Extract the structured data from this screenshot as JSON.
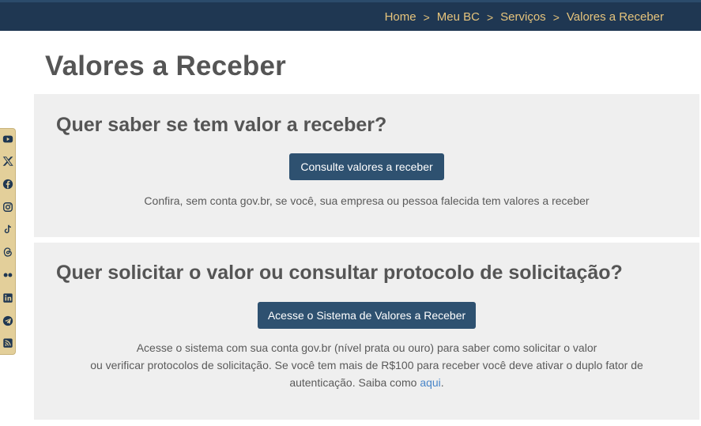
{
  "breadcrumb": {
    "items": [
      "Home",
      "Meu BC",
      "Serviços",
      "Valores a Receber"
    ],
    "separator": ">"
  },
  "page": {
    "title": "Valores a Receber"
  },
  "section1": {
    "heading": "Quer saber se tem valor a receber?",
    "button": "Consulte valores a receber",
    "description": "Confira, sem conta gov.br, se você, sua empresa ou pessoa falecida tem valores a receber"
  },
  "section2": {
    "heading": "Quer solicitar o valor ou consultar protocolo de solicitação?",
    "button": "Acesse o Sistema de Valores a Receber",
    "description_line1": "Acesse o sistema com sua conta gov.br (nível prata ou ouro) para saber como solicitar o valor",
    "description_line2": "ou verificar protocolos de solicitação. Se você tem mais de R$100 para receber você deve ativar o duplo fator de autenticação. Saiba como",
    "link": "aqui",
    "end": "."
  },
  "social_icons": [
    "youtube-icon",
    "x-icon",
    "facebook-icon",
    "instagram-icon",
    "tiktok-icon",
    "threads-icon",
    "flickr-icon",
    "linkedin-icon",
    "telegram-icon",
    "rss-icon"
  ],
  "colors": {
    "topbar": "#1f3752",
    "breadcrumb": "#e6c47c",
    "button": "#2e5170",
    "card": "#efefef",
    "social_bar": "#e3cf9a",
    "link": "#4a86c8"
  }
}
